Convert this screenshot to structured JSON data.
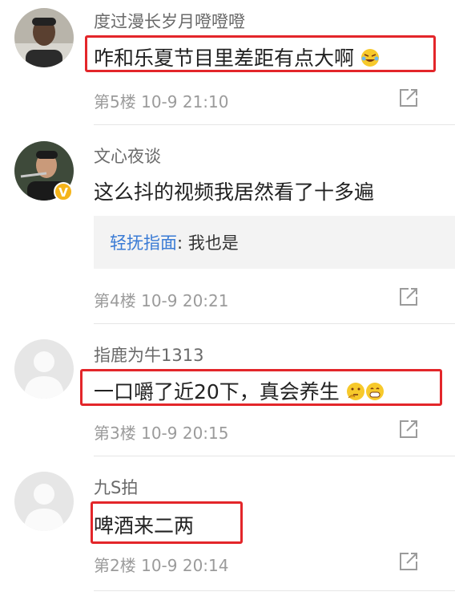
{
  "colors": {
    "highlight": "#e3262a",
    "reply_name": "#3a7bd5",
    "badge": "#f5b51b"
  },
  "comments": [
    {
      "username": "度过漫长岁月噔噔噔",
      "content": "咋和乐夏节目里差距有点大啊",
      "emoji": "laughing-tears-emoji",
      "floor": "第5楼",
      "time": "10-9 21:10"
    },
    {
      "username": "文心夜谈",
      "content": "这么抖的视频我居然看了十多遍",
      "badge": "V",
      "reply": {
        "name": "轻抚指面",
        "sep": ": ",
        "text": "我也是"
      },
      "floor": "第4楼",
      "time": "10-9 20:21"
    },
    {
      "username": "指鹿为牛1313",
      "content": "一口嚼了近20下，真会养生",
      "emoji": "thinking-emoji grinning-emoji",
      "floor": "第3楼",
      "time": "10-9 20:15"
    },
    {
      "username": "九S拍",
      "content": "啤酒来二两",
      "floor": "第2楼",
      "time": "10-9 20:14"
    }
  ]
}
